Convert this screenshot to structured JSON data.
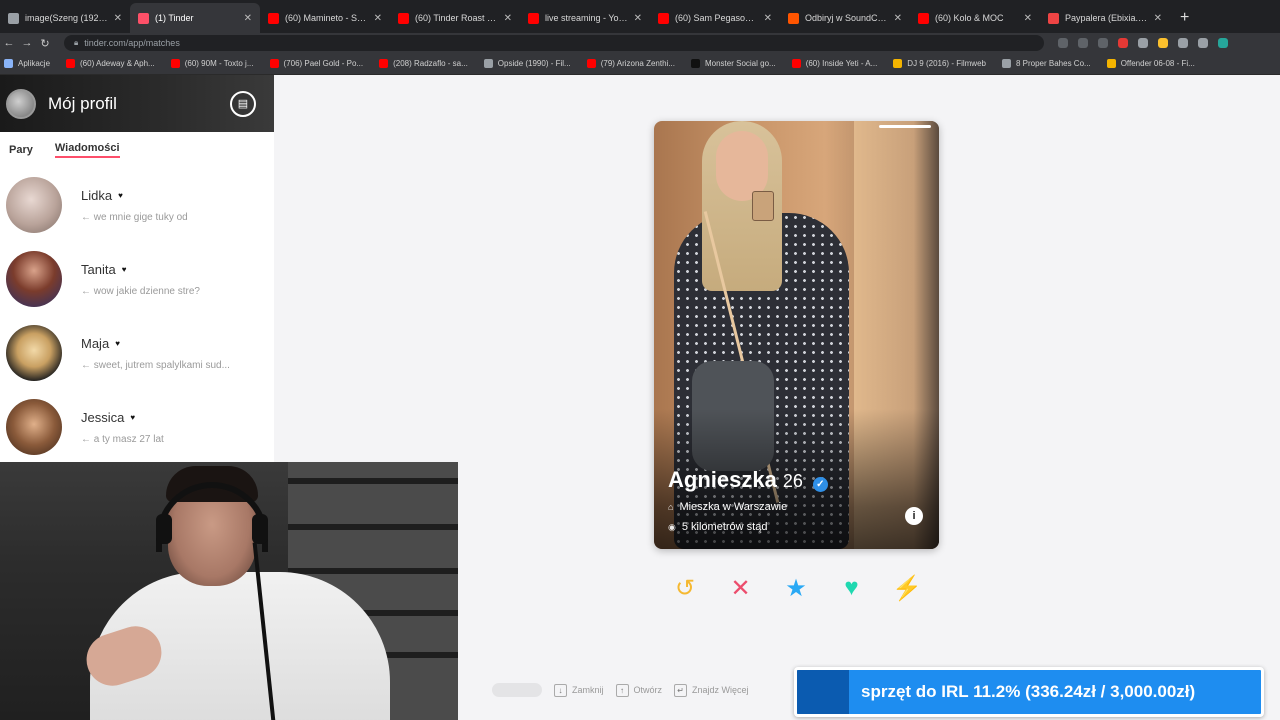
{
  "browser": {
    "tabs": [
      {
        "label": "image(Szeng (1920x50...",
        "color": "#9aa0a6"
      },
      {
        "label": "(1) Tinder",
        "color": "#fd5068",
        "active": true
      },
      {
        "label": "(60) Mamineto - Sweet...",
        "color": "#ff0000"
      },
      {
        "label": "(60) Tinder Roast Mo...",
        "color": "#ff0000"
      },
      {
        "label": "live streaming - YouT...",
        "color": "#ff0000"
      },
      {
        "label": "(60) Sam Pegasos - D...",
        "color": "#ff0000"
      },
      {
        "label": "Odbiryj w SoundCloud",
        "color": "#ff5500"
      },
      {
        "label": "(60) Kolo & MOC",
        "color": "#ff0000"
      },
      {
        "label": "Paypalera (Ebixia...) +",
        "color": "#e44"
      }
    ],
    "url": "tinder.com/app/matches",
    "bookmarks": [
      {
        "label": "Aplikacje",
        "color": "#8ab4f8"
      },
      {
        "label": "(60) Adeway & Aph...",
        "color": "#ff0000"
      },
      {
        "label": "(60) 90M - Toxto j...",
        "color": "#ff0000"
      },
      {
        "label": "(706) Pael Gold - Po...",
        "color": "#ff0000"
      },
      {
        "label": "(208) Radzaflo - sa...",
        "color": "#ff0000"
      },
      {
        "label": "Opside (1990) - Fil...",
        "color": "#9aa0a6"
      },
      {
        "label": "(79) Arizona Zenthi...",
        "color": "#ff0000"
      },
      {
        "label": "Monster Social go...",
        "color": "#111111"
      },
      {
        "label": "(60) Inside Yeti - A...",
        "color": "#ff0000"
      },
      {
        "label": "DJ 9 (2016) - Filmweb",
        "color": "#f4b400"
      },
      {
        "label": "8 Proper Bahes Co...",
        "color": "#9aa0a6"
      },
      {
        "label": "Offender 06-08 - Fi...",
        "color": "#f4b400"
      }
    ]
  },
  "sidebar": {
    "title": "Mój profil",
    "tabs": [
      "Pary",
      "Wiadomości"
    ],
    "messages": [
      {
        "name": "Lidka",
        "preview": "← we mnie gige tuky od"
      },
      {
        "name": "Tanita",
        "preview": "← wow jakie dzienne stre?"
      },
      {
        "name": "Maja",
        "preview": "← sweet, jutrem spalylkami sud..."
      },
      {
        "name": "Jessica",
        "preview": "← a ty masz 27 lat"
      }
    ]
  },
  "card": {
    "name": "Agnieszka",
    "age": "26",
    "location": "Mieszka w Warszawie",
    "distance": "5 kilometrów stąd"
  },
  "actions": [
    {
      "name": "rewind-button",
      "glyph": "↺",
      "color": "#f5b831"
    },
    {
      "name": "nope-button",
      "glyph": "✕",
      "color": "#ec4d6d"
    },
    {
      "name": "super-like-button",
      "glyph": "★",
      "color": "#2aa9f5"
    },
    {
      "name": "like-button",
      "glyph": "♥",
      "color": "#1fd8b0"
    },
    {
      "name": "boost-button",
      "glyph": "⚡",
      "color": "#a45bde"
    }
  ],
  "hints": [
    {
      "key": "↓",
      "label": "Zamknij"
    },
    {
      "key": "↑",
      "label": "Otwórz"
    },
    {
      "key": "↵",
      "label": "Znajdz Więcej"
    }
  ],
  "goal": {
    "text": "sprzęt do IRL 11.2% (336.24zł / 3,000.00zł)",
    "progress": 0.112
  }
}
